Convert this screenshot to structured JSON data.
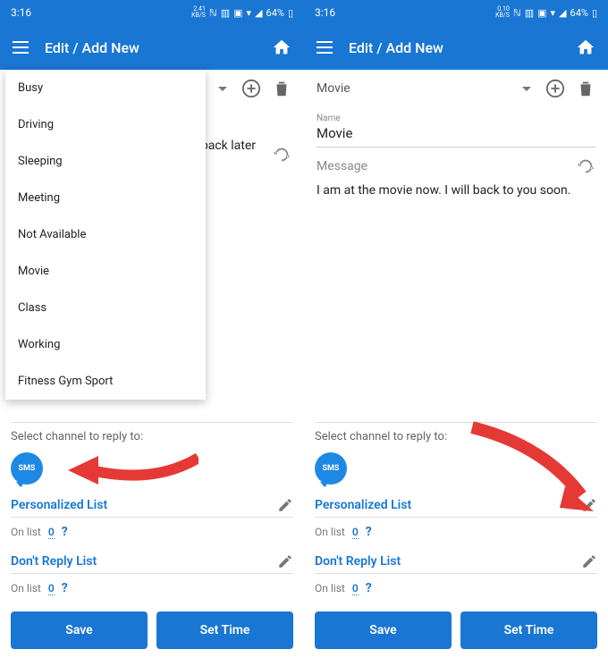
{
  "status": {
    "time": "3:16",
    "left_speed": "2.41",
    "left_unit": "KB/S",
    "right_speed": "0.10",
    "right_unit": "KB/S",
    "battery": "64%"
  },
  "appbar": {
    "title": "Edit / Add New"
  },
  "left": {
    "dropdown": [
      "Busy",
      "Driving",
      "Sleeping",
      "Meeting",
      "Not Available",
      "Movie",
      "Class",
      "Working",
      "Fitness Gym Sport"
    ],
    "visible_msg_fragment": "back later"
  },
  "right": {
    "selected": "Movie",
    "name_label": "Name",
    "name_value": "Movie",
    "message_label": "Message",
    "message_text": "I am at the movie now. I will back to you soon."
  },
  "bottom": {
    "channel_label": "Select channel to reply to:",
    "sms": "SMS",
    "list1": "Personalized List",
    "list2": "Don't Reply List",
    "onlist": "On list",
    "count": "0",
    "q": "?",
    "save": "Save",
    "settime": "Set Time"
  }
}
